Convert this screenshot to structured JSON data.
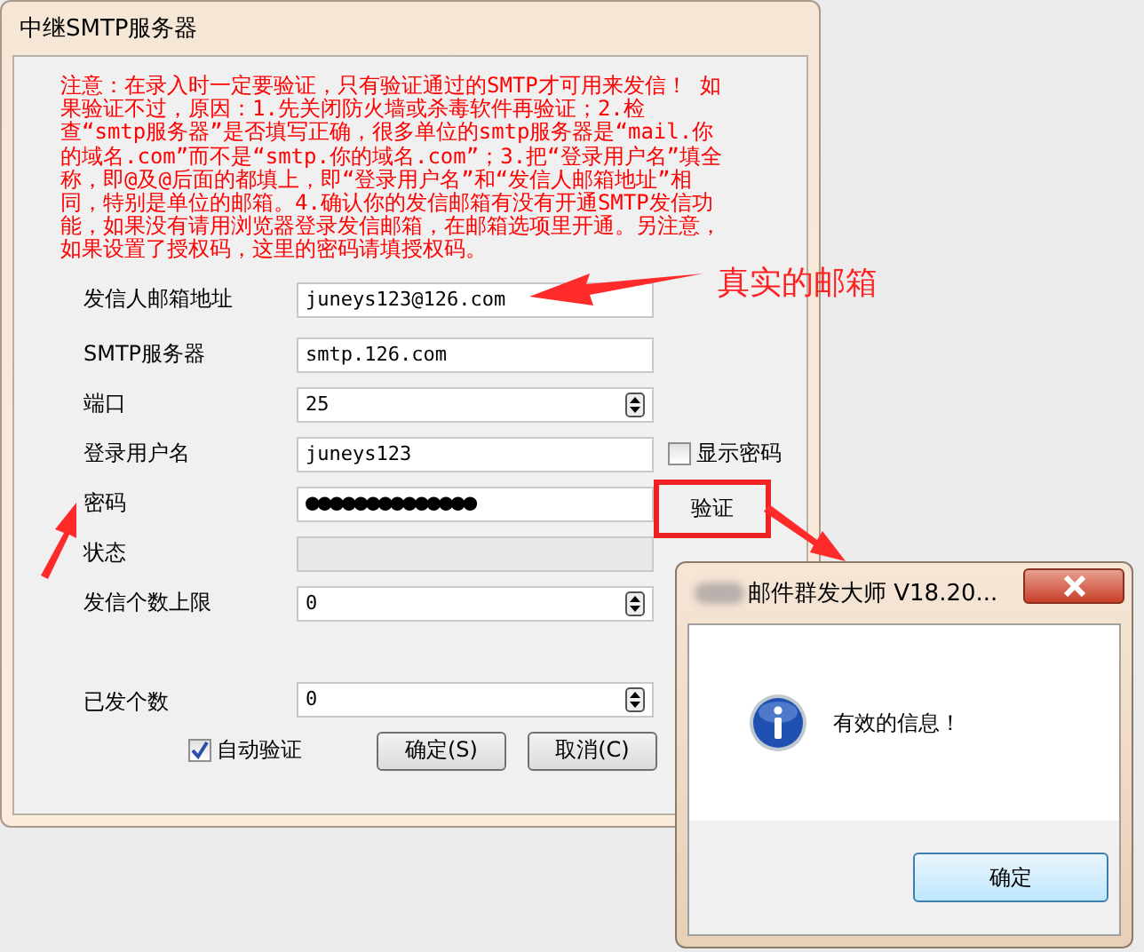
{
  "window": {
    "title": "中继SMTP服务器"
  },
  "notice": "注意：在录入时一定要验证，只有验证通过的SMTP才可用来发信！ 如果验证不过，原因：1.先关闭防火墙或杀毒软件再验证；2.检查“smtp服务器”是否填写正确，很多单位的smtp服务器是“mail.你的域名.com”而不是“smtp.你的域名.com”；3.把“登录用户名”填全称，即@及@后面的都填上，即“登录用户名”和“发信人邮箱地址”相同，特别是单位的邮箱。4.确认你的发信邮箱有没有开通SMTP发信功能，如果没有请用浏览器登录发信邮箱，在邮箱选项里开通。另注意，如果设置了授权码，这里的密码请填授权码。",
  "fields": [
    {
      "label": "发信人邮箱地址",
      "kind": "text",
      "value": "juneys123@126.com"
    },
    {
      "label": "SMTP服务器",
      "kind": "text",
      "value": "smtp.126.com"
    },
    {
      "label": "端口",
      "kind": "spin",
      "value": "25"
    },
    {
      "label": "登录用户名",
      "kind": "text",
      "value": "juneys123",
      "extra": {
        "kind": "checkbox",
        "label": "显示密码",
        "checked": false
      }
    },
    {
      "label": "密码",
      "kind": "password",
      "value": "●●●●●●●●●●●●●●",
      "extra": {
        "kind": "button",
        "label": "验证"
      }
    },
    {
      "label": "状态",
      "kind": "status"
    },
    {
      "label": "发信个数上限",
      "kind": "spin",
      "value": "0"
    },
    {
      "label": "已发个数",
      "kind": "spin",
      "value": "0"
    }
  ],
  "auto_verify": {
    "label": "自动验证",
    "checked": true
  },
  "buttons": [
    "确定(S)",
    "取消(C)"
  ],
  "annotation": {
    "label": "真实的邮箱"
  },
  "dialog": {
    "title": "邮件群发大师 V18.20...",
    "message": "有效的信息！",
    "button": "确定"
  }
}
